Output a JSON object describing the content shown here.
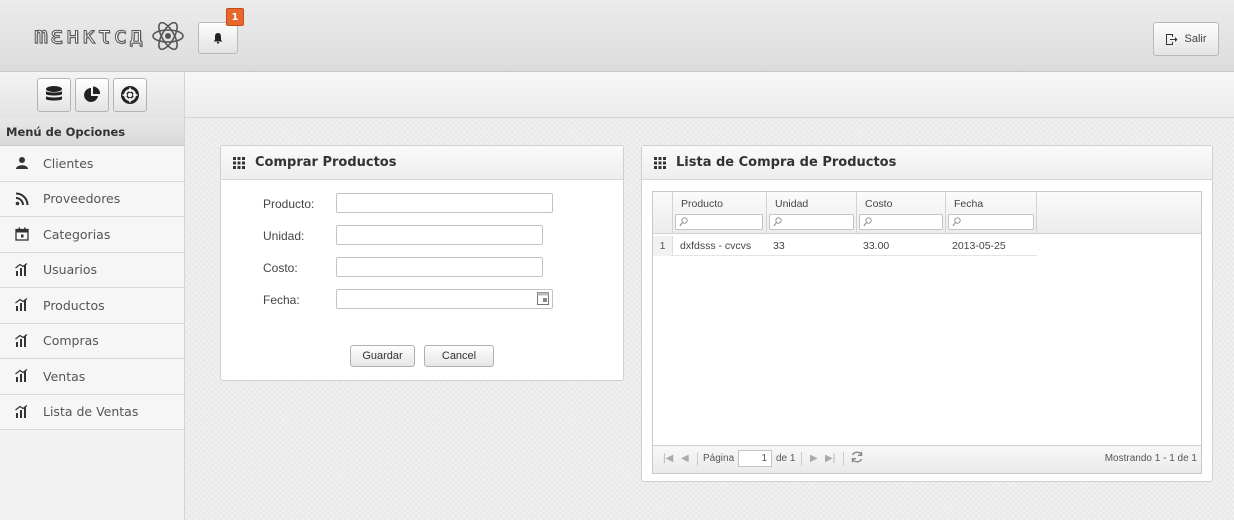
{
  "header": {
    "logo_text": "mεнкτcд",
    "notification_count": "1",
    "logout_label": "Salir"
  },
  "sidebar": {
    "title": "Menú de Opciones",
    "items": [
      {
        "label": "Clientes",
        "icon": "user-icon"
      },
      {
        "label": "Proveedores",
        "icon": "rss-icon"
      },
      {
        "label": "Categorias",
        "icon": "calendar-icon"
      },
      {
        "label": "Usuarios",
        "icon": "bar-chart-icon"
      },
      {
        "label": "Productos",
        "icon": "bar-chart-icon"
      },
      {
        "label": "Compras",
        "icon": "bar-chart-icon"
      },
      {
        "label": "Ventas",
        "icon": "bar-chart-icon"
      },
      {
        "label": "Lista de Ventas",
        "icon": "bar-chart-icon"
      }
    ]
  },
  "shortcuts": [
    "database-icon",
    "pie-chart-icon",
    "lifebuoy-icon"
  ],
  "form": {
    "title": "Comprar Productos",
    "fields": {
      "producto": {
        "label": "Producto:",
        "value": ""
      },
      "unidad": {
        "label": "Unidad:",
        "value": ""
      },
      "costo": {
        "label": "Costo:",
        "value": ""
      },
      "fecha": {
        "label": "Fecha:",
        "value": ""
      }
    },
    "save_label": "Guardar",
    "cancel_label": "Cancel"
  },
  "list": {
    "title": "Lista de Compra de Productos",
    "columns": [
      "Producto",
      "Unidad",
      "Costo",
      "Fecha"
    ],
    "rows": [
      {
        "num": "1",
        "producto": "dxfdsss - cvcvs",
        "unidad": "33",
        "costo": "33.00",
        "fecha": "2013-05-25"
      }
    ],
    "pager": {
      "page_label": "Página",
      "page_value": "1",
      "of_label": "de 1",
      "summary": "Mostrando 1 - 1 de 1"
    }
  },
  "colors": {
    "badge": "#e8672c",
    "panel_border": "#cfcfcf",
    "header_bg": "#e4e4e4"
  }
}
